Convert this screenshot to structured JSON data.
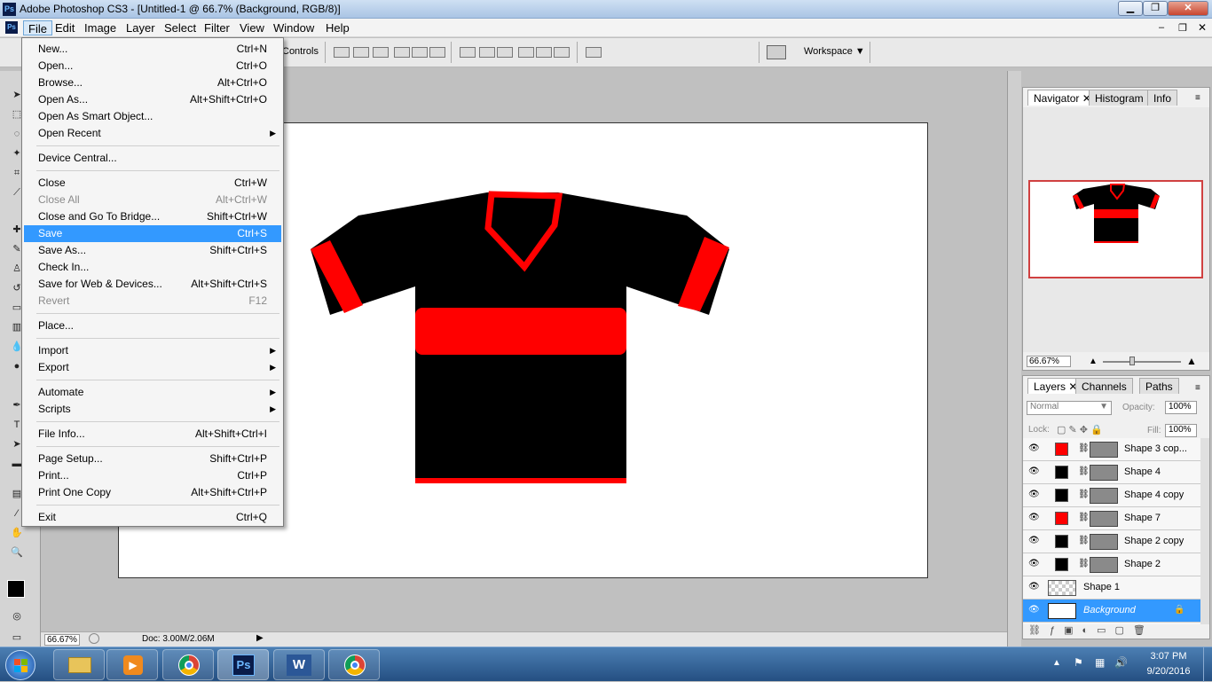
{
  "window": {
    "title": "Adobe Photoshop CS3 - [Untitled-1 @ 66.7% (Background, RGB/8)]",
    "app_icon": "Ps"
  },
  "menubar": {
    "items": [
      "File",
      "Edit",
      "Image",
      "Layer",
      "Select",
      "Filter",
      "View",
      "Window",
      "Help"
    ],
    "active": "File"
  },
  "options_bar": {
    "controls_label": "Controls",
    "workspace_label": "Workspace"
  },
  "file_menu": {
    "groups": [
      [
        {
          "label": "New...",
          "shortcut": "Ctrl+N"
        },
        {
          "label": "Open...",
          "shortcut": "Ctrl+O"
        },
        {
          "label": "Browse...",
          "shortcut": "Alt+Ctrl+O"
        },
        {
          "label": "Open As...",
          "shortcut": "Alt+Shift+Ctrl+O"
        },
        {
          "label": "Open As Smart Object...",
          "shortcut": ""
        },
        {
          "label": "Open Recent",
          "shortcut": "",
          "submenu": true
        }
      ],
      [
        {
          "label": "Device Central...",
          "shortcut": ""
        }
      ],
      [
        {
          "label": "Close",
          "shortcut": "Ctrl+W"
        },
        {
          "label": "Close All",
          "shortcut": "Alt+Ctrl+W",
          "disabled": true
        },
        {
          "label": "Close and Go To Bridge...",
          "shortcut": "Shift+Ctrl+W"
        },
        {
          "label": "Save",
          "shortcut": "Ctrl+S",
          "highlighted": true
        },
        {
          "label": "Save As...",
          "shortcut": "Shift+Ctrl+S"
        },
        {
          "label": "Check In...",
          "shortcut": ""
        },
        {
          "label": "Save for Web & Devices...",
          "shortcut": "Alt+Shift+Ctrl+S"
        },
        {
          "label": "Revert",
          "shortcut": "F12",
          "disabled": true
        }
      ],
      [
        {
          "label": "Place...",
          "shortcut": ""
        }
      ],
      [
        {
          "label": "Import",
          "shortcut": "",
          "submenu": true
        },
        {
          "label": "Export",
          "shortcut": "",
          "submenu": true
        }
      ],
      [
        {
          "label": "Automate",
          "shortcut": "",
          "submenu": true
        },
        {
          "label": "Scripts",
          "shortcut": "",
          "submenu": true
        }
      ],
      [
        {
          "label": "File Info...",
          "shortcut": "Alt+Shift+Ctrl+I"
        }
      ],
      [
        {
          "label": "Page Setup...",
          "shortcut": "Shift+Ctrl+P"
        },
        {
          "label": "Print...",
          "shortcut": "Ctrl+P"
        },
        {
          "label": "Print One Copy",
          "shortcut": "Alt+Shift+Ctrl+P"
        }
      ],
      [
        {
          "label": "Exit",
          "shortcut": "Ctrl+Q"
        }
      ]
    ]
  },
  "status_bar": {
    "zoom": "66.67%",
    "doc_info": "Doc: 3.00M/2.06M"
  },
  "navigator_panel": {
    "tabs": [
      "Navigator",
      "Histogram",
      "Info"
    ],
    "zoom": "66.67%"
  },
  "layers_panel": {
    "tabs": [
      "Layers",
      "Channels",
      "Paths"
    ],
    "blend_mode": "Normal",
    "opacity_label": "Opacity:",
    "opacity": "100%",
    "lock_label": "Lock:",
    "fill_label": "Fill:",
    "fill": "100%",
    "layers": [
      {
        "name": "Shape 3 cop...",
        "swatch": "#ff0000"
      },
      {
        "name": "Shape 4",
        "swatch": "#000000"
      },
      {
        "name": "Shape 4 copy",
        "swatch": "#000000"
      },
      {
        "name": "Shape 7",
        "swatch": "#ff0000"
      },
      {
        "name": "Shape 2 copy",
        "swatch": "#000000"
      },
      {
        "name": "Shape 2",
        "swatch": "#000000"
      },
      {
        "name": "Shape 1",
        "swatch": "checker"
      },
      {
        "name": "Background",
        "swatch": "#ffffff",
        "selected": true
      }
    ]
  },
  "taskbar": {
    "time": "3:07 PM",
    "date": "9/20/2016",
    "photoshop_label": "Ps",
    "word_label": "W"
  },
  "colors": {
    "shirt_body": "#000000",
    "shirt_trim": "#ff0000",
    "menu_highlight": "#3399ff",
    "layer_selected": "#3399ff"
  }
}
